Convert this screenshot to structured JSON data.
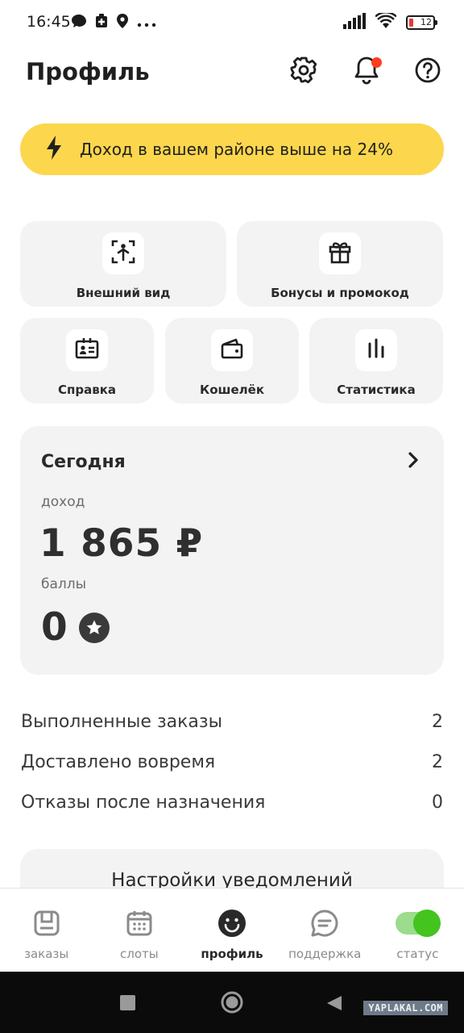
{
  "status_bar": {
    "time": "16:45",
    "battery": "12",
    "icons": [
      "chat-icon",
      "medical-icon",
      "location-icon",
      "more-dots-icon",
      "signal-icon",
      "wifi-icon",
      "battery-icon"
    ]
  },
  "header": {
    "title": "Профиль",
    "icons": [
      "gear-icon",
      "bell-icon",
      "help-icon"
    ]
  },
  "banner": {
    "text": "Доход в вашем районе выше на 24%",
    "icon": "lightning-icon",
    "color": "#fcd64c"
  },
  "tiles": [
    {
      "label": "Внешний вид",
      "icon": "person-frame-icon"
    },
    {
      "label": "Бонусы и промокод",
      "icon": "gift-icon"
    },
    {
      "label": "Справка",
      "icon": "id-card-icon"
    },
    {
      "label": "Кошелёк",
      "icon": "wallet-icon"
    },
    {
      "label": "Статистика",
      "icon": "bar-chart-icon"
    }
  ],
  "today": {
    "title": "Сегодня",
    "income_label": "доход",
    "income_value": "1 865 ₽",
    "points_label": "баллы",
    "points_value": "0"
  },
  "stats": [
    {
      "label": "Выполненные заказы",
      "value": "2"
    },
    {
      "label": "Доставлено вовремя",
      "value": "2"
    },
    {
      "label": "Отказы после назначения",
      "value": "0"
    }
  ],
  "notifications_card": {
    "title": "Настройки уведомлений"
  },
  "bottom_nav": {
    "items": [
      {
        "label": "заказы",
        "icon": "orders-icon",
        "active": false
      },
      {
        "label": "слоты",
        "icon": "calendar-icon",
        "active": false
      },
      {
        "label": "профиль",
        "icon": "smiley-icon",
        "active": true
      },
      {
        "label": "поддержка",
        "icon": "chat-bubble-icon",
        "active": false
      },
      {
        "label": "статус",
        "icon": "toggle-icon",
        "active": false,
        "toggle_on": true
      }
    ]
  },
  "system_nav": {
    "watermark": "YAPLAKAL.COM"
  },
  "colors": {
    "accent_yellow": "#fcd64c",
    "card_bg": "#f3f3f3",
    "notification_dot": "#fc3f1d",
    "status_green": "#45c31e"
  }
}
